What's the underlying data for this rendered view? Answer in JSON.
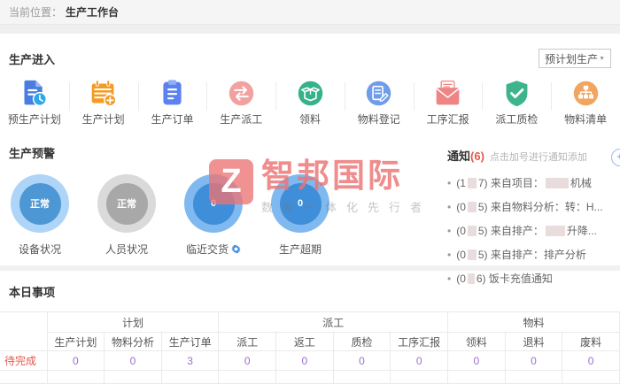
{
  "breadcrumb": {
    "label": "当前位置：",
    "current": "生产工作台"
  },
  "entry": {
    "title": "生产进入",
    "dropdown_value": "预计划生产",
    "items": [
      {
        "label": "预生产计划",
        "icon": "doc-clock"
      },
      {
        "label": "生产计划",
        "icon": "calendar-plus"
      },
      {
        "label": "生产订单",
        "icon": "clipboard"
      },
      {
        "label": "生产派工",
        "icon": "swap-arrows"
      },
      {
        "label": "领料",
        "icon": "open-box"
      },
      {
        "label": "物料登记",
        "icon": "doc-pen"
      },
      {
        "label": "工序汇报",
        "icon": "envelope-report"
      },
      {
        "label": "派工质检",
        "icon": "shield-check"
      },
      {
        "label": "物料清单",
        "icon": "sitemap"
      }
    ]
  },
  "alerts": {
    "title": "生产预警",
    "items": [
      {
        "label": "设备状况",
        "value": "正常",
        "outer": "#aed5f7",
        "inner": "#4d97d5",
        "gear": false
      },
      {
        "label": "人员状况",
        "value": "正常",
        "outer": "#dadada",
        "inner": "#a8a8a8",
        "gear": false
      },
      {
        "label": "临近交货",
        "value": "0",
        "outer": "#7fb9ef",
        "inner": "#3e8ed9",
        "gear": true
      },
      {
        "label": "生产超期",
        "value": "0",
        "outer": "#7fb9ef",
        "inner": "#3e8ed9",
        "gear": false
      }
    ]
  },
  "notifications": {
    "title": "通知",
    "count": "(6)",
    "hint": "点击加号进行通知添加",
    "add_label": "+",
    "items": [
      {
        "segments": [
          {
            "text": "(1"
          },
          {
            "redact": 10
          },
          {
            "text": "7) 来自项目："
          },
          {
            "redact": 26
          },
          {
            "text": "机械"
          }
        ]
      },
      {
        "segments": [
          {
            "text": "(0"
          },
          {
            "redact": 10
          },
          {
            "text": "5) 来自物料分析：转：H..."
          }
        ]
      },
      {
        "segments": [
          {
            "text": "(0"
          },
          {
            "redact": 10
          },
          {
            "text": "5) 来自排产："
          },
          {
            "redact": 22
          },
          {
            "text": "升降..."
          }
        ]
      },
      {
        "segments": [
          {
            "text": "(0"
          },
          {
            "redact": 10
          },
          {
            "text": "5) 来自排产：排产分析"
          }
        ]
      },
      {
        "segments": [
          {
            "text": "(0"
          },
          {
            "redact": 8
          },
          {
            "text": "6) 饭卡充值通知"
          }
        ]
      }
    ]
  },
  "watermark": {
    "logo": "Z",
    "brand": "智邦国际",
    "slogan": "数智一体化先行者"
  },
  "today": {
    "title": "本日事项",
    "row_label": "待完成",
    "groups": [
      {
        "label": "计划",
        "cols": [
          "生产计划",
          "物料分析",
          "生产订单"
        ]
      },
      {
        "label": "派工",
        "cols": [
          "派工",
          "返工",
          "质检",
          "工序汇报"
        ]
      },
      {
        "label": "物料",
        "cols": [
          "领料",
          "退料",
          "废料"
        ]
      }
    ],
    "values": [
      "0",
      "0",
      "3",
      "0",
      "0",
      "0",
      "0",
      "0",
      "0",
      "0"
    ]
  },
  "colors": {
    "accent_red": "#e5574d",
    "value_purple": "#9a6fd0",
    "brand_red": "#ec7373",
    "link_blue": "#4a90d9"
  }
}
